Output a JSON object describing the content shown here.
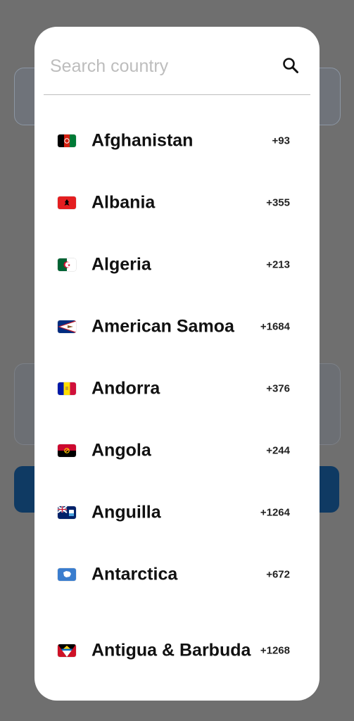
{
  "search": {
    "placeholder": "Search country",
    "icon": "search-icon"
  },
  "countries": [
    {
      "name": "Afghanistan",
      "code": "+93",
      "flag_colors": [
        "#000000",
        "#d32011",
        "#007a36"
      ]
    },
    {
      "name": "Albania",
      "code": "+355",
      "flag_colors": [
        "#e41e20",
        "#000000"
      ]
    },
    {
      "name": "Algeria",
      "code": "+213",
      "flag_colors": [
        "#006233",
        "#ffffff",
        "#d21034"
      ]
    },
    {
      "name": "American Samoa",
      "code": "+1684",
      "flag_colors": [
        "#002b7f",
        "#ffffff",
        "#bf2033"
      ]
    },
    {
      "name": "Andorra",
      "code": "+376",
      "flag_colors": [
        "#0018a8",
        "#fedf00",
        "#d0103a"
      ]
    },
    {
      "name": "Angola",
      "code": "+244",
      "flag_colors": [
        "#cc092f",
        "#000000",
        "#ffcb00"
      ]
    },
    {
      "name": "Anguilla",
      "code": "+1264",
      "flag_colors": [
        "#012169",
        "#ffffff",
        "#c8102e"
      ]
    },
    {
      "name": "Antarctica",
      "code": "+672",
      "flag_colors": [
        "#3a7dce",
        "#ffffff"
      ]
    },
    {
      "name": "Antigua & Barbuda",
      "code": "+1268",
      "flag_colors": [
        "#ce1126",
        "#000000",
        "#0072c6",
        "#fcd116"
      ]
    }
  ]
}
